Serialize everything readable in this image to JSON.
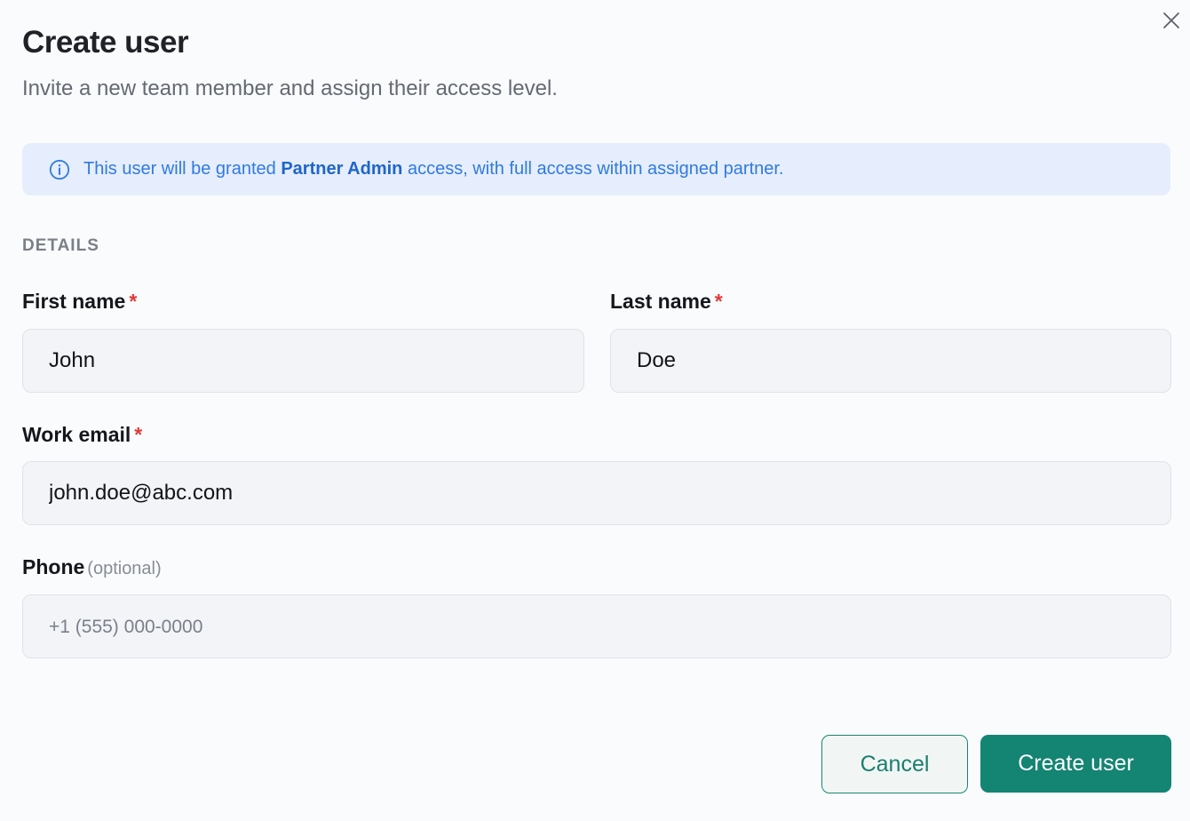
{
  "dialog": {
    "title": "Create user",
    "subtitle": "Invite a new team member and assign their access level."
  },
  "banner": {
    "text_before": "This user will be granted ",
    "role": "Partner Admin",
    "text_after": " access, with full access within assigned partner."
  },
  "section": {
    "details_label": "DETAILS"
  },
  "fields": {
    "first_name": {
      "label": "First name",
      "required_mark": "*",
      "value": "John"
    },
    "last_name": {
      "label": "Last name",
      "required_mark": "*",
      "value": "Doe"
    },
    "email": {
      "label": "Work email",
      "required_mark": "*",
      "value": "john.doe@abc.com"
    },
    "phone": {
      "label": "Phone",
      "optional_text": "(optional)",
      "value": "",
      "placeholder": "+1 (555) 000-0000"
    }
  },
  "actions": {
    "cancel_label": "Cancel",
    "submit_label": "Create user"
  },
  "icons": {
    "close": "close-icon",
    "info": "info-icon"
  },
  "colors": {
    "accent": "#148473",
    "info_text": "#2f7be0",
    "info_bg": "#e6edfc",
    "required": "#e03a3a"
  }
}
